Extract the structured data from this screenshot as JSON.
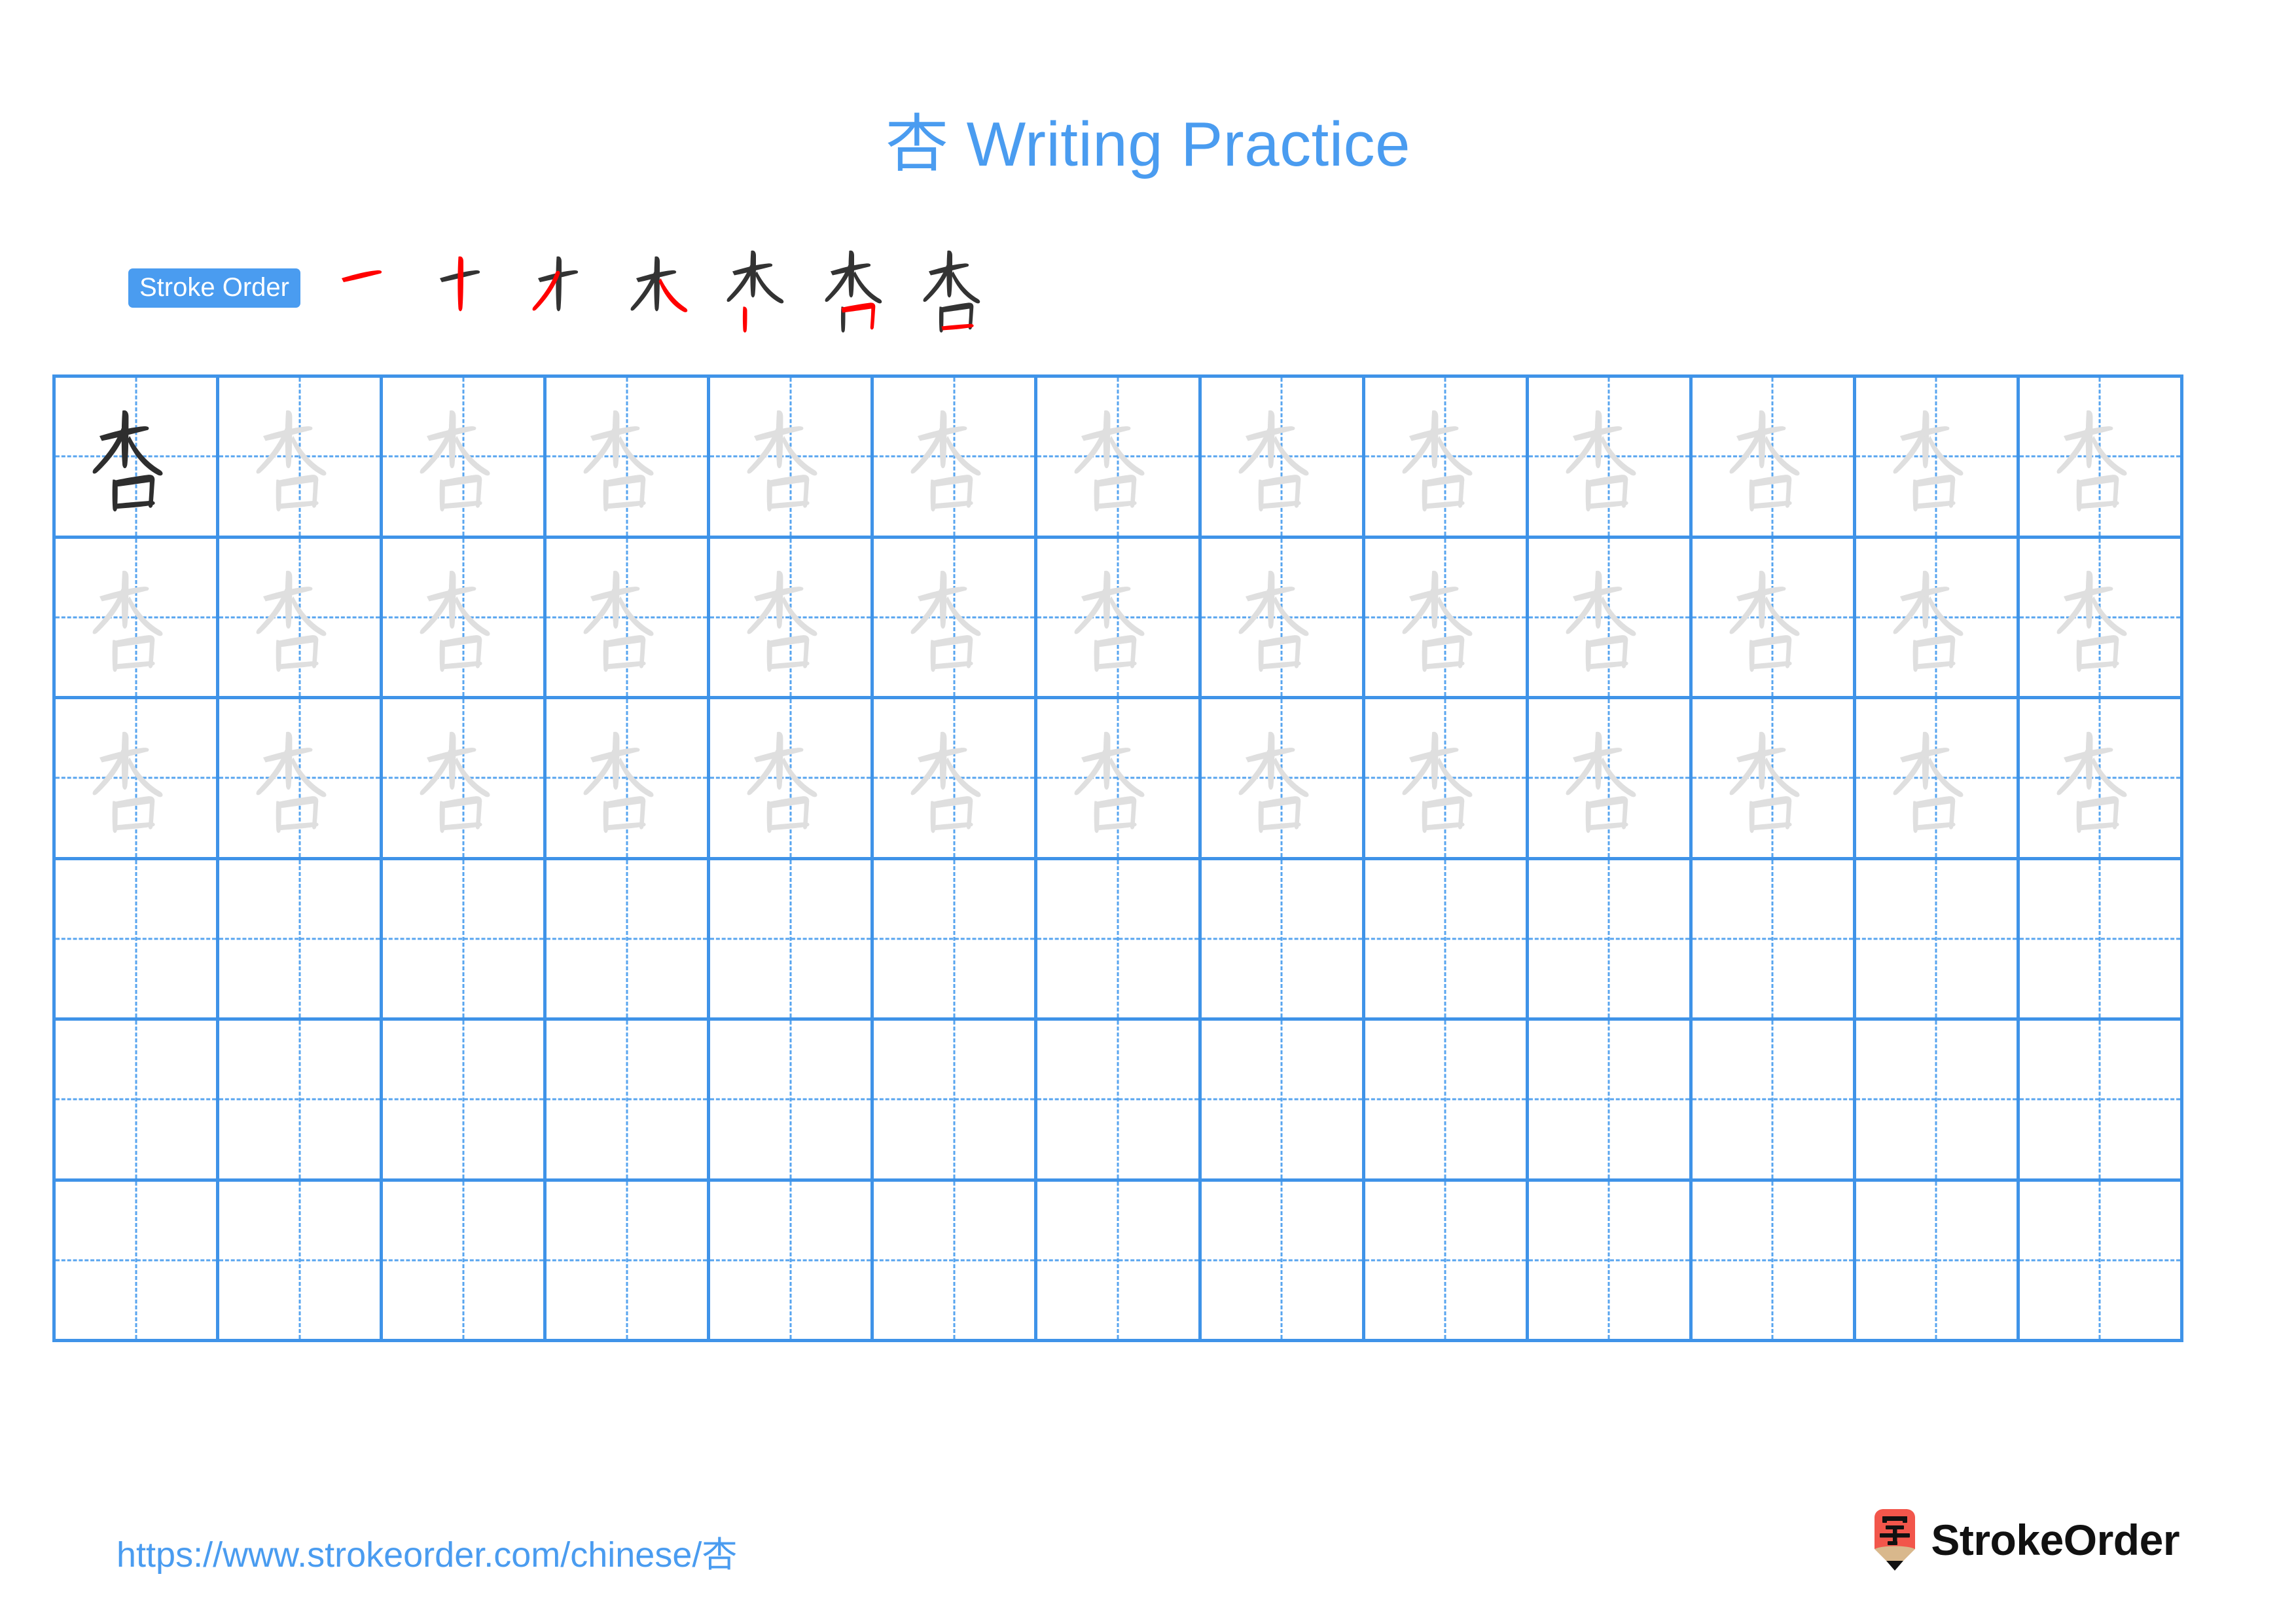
{
  "page": {
    "character": "杏",
    "title": "杏 Writing Practice",
    "title_character": "杏",
    "title_text": " Writing Practice",
    "background_color": "#ffffff",
    "accent_color": "#4a9cf0",
    "grid_line_color": "#3f93e8",
    "guide_line_color": "#58a5ef",
    "traced_char_color": "#dfdfdf",
    "model_char_color": "#2e2e2e",
    "stroke_new_color": "#ff0000",
    "stroke_old_color": "#333333"
  },
  "stroke_order": {
    "badge_label": "Stroke Order",
    "total_strokes": 7,
    "steps": [
      {
        "index": 1,
        "name": "heng",
        "description": "horizontal"
      },
      {
        "index": 2,
        "name": "shu",
        "description": "vertical"
      },
      {
        "index": 3,
        "name": "pie",
        "description": "left-falling"
      },
      {
        "index": 4,
        "name": "na",
        "description": "right-falling"
      },
      {
        "index": 5,
        "name": "shu-kou",
        "description": "vertical of mouth radical"
      },
      {
        "index": 6,
        "name": "hengzhe",
        "description": "horizontal turn"
      },
      {
        "index": 7,
        "name": "heng-close",
        "description": "closing horizontal"
      }
    ]
  },
  "grid": {
    "columns": 13,
    "rows": 6,
    "cells_with_model_character": 1,
    "cells_with_traced_character": 38,
    "empty_rows": 3
  },
  "footer": {
    "url": "https://www.strokeorder.com/chinese/杏",
    "brand_name": "StrokeOrder",
    "logo_character": "字",
    "logo_body_color": "#f2564b",
    "logo_wood_color": "#d9b88c",
    "logo_tip_color": "#111111"
  }
}
